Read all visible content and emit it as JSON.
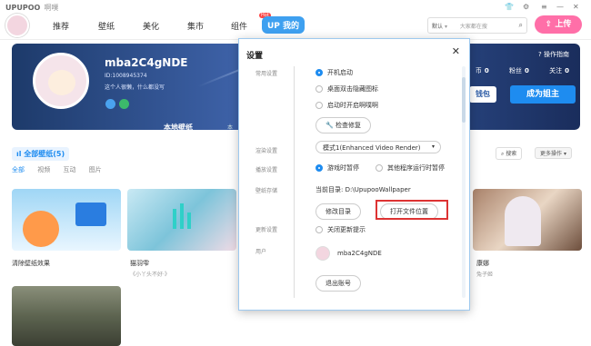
{
  "app": {
    "name": "UPUPOO",
    "subtitle": "啊噗"
  },
  "nav": {
    "items": [
      "推荐",
      "壁纸",
      "美化",
      "集市",
      "组件",
      "我的"
    ],
    "hot_badge": "Hot"
  },
  "search": {
    "scope": "默认",
    "placeholder": "大家都在搜"
  },
  "upload_label": "上传",
  "profile": {
    "username": "mba2C4gNDE",
    "id": "ID:1008945374",
    "bio": "这个人很懒，什么都没写",
    "guide": "操作指南",
    "stats": [
      {
        "label": "币",
        "value": "0"
      },
      {
        "label": "粉丝",
        "value": "0"
      },
      {
        "label": "关注",
        "value": "0"
      }
    ],
    "wallet_label": "钱包",
    "owner_label": "成为姐主",
    "tab_local": "本地壁纸",
    "tab_local_other": "本"
  },
  "wallpapers": {
    "all_label": "全部壁纸(5)",
    "filters": [
      "全部",
      "视频",
      "互动",
      "图片"
    ],
    "search_btn": "搜索",
    "more_btn": "更多操作",
    "cards": [
      {
        "title": "清除壁纸效果",
        "sub": ""
      },
      {
        "title": "猫羽雫",
        "sub": "《小丫头不好·》"
      },
      {
        "title": "康娜",
        "sub": "兔子姬"
      }
    ]
  },
  "settings": {
    "title": "设置",
    "sections": [
      "常用设置",
      "渲染设置",
      "播放设置",
      "壁纸存储",
      "更新设置",
      "用户"
    ],
    "options": {
      "autostart": "开机启动",
      "dblclick_hide": "桌面双击隐藏图标",
      "auto_mute": "启动时开启啊噗啊",
      "check_repair": "检查修复",
      "render_mode": "模式1(Enhanced Video Render)",
      "pause_game": "游戏时暂停",
      "pause_other": "其他程序运行时暂停",
      "current_dir_label": "当前目录:",
      "current_dir": "D:\\UpupooWallpaper",
      "change_dir": "修改目录",
      "open_location": "打开文件位置",
      "close_update": "关闭更新提示",
      "user_name": "mba2C4gNDE",
      "logout": "退出账号"
    }
  },
  "colors": {
    "accent": "#1e8cf0",
    "pink": "#ff6fa8",
    "highlight": "#d33333"
  }
}
